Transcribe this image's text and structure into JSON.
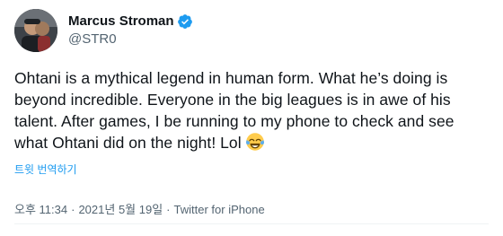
{
  "author": {
    "display_name": "Marcus Stroman",
    "handle": "@STR0",
    "verified": true
  },
  "tweet": {
    "text": "Ohtani is a mythical legend in human form. What he’s doing is beyond incredible. Everyone in the big leagues is in awe of his talent. After games, I be running to my phone to check and see what Ohtani did on the night! Lol",
    "emoji": "face-with-tears-of-joy",
    "translate_label": "트윗 번역하기"
  },
  "meta": {
    "time": "오후 11:34",
    "separator": "·",
    "date": "2021년 5월 19일",
    "source": "Twitter for iPhone"
  },
  "colors": {
    "accent": "#1d9bf0",
    "secondary_text": "#536471",
    "primary_text": "#0f1419"
  }
}
